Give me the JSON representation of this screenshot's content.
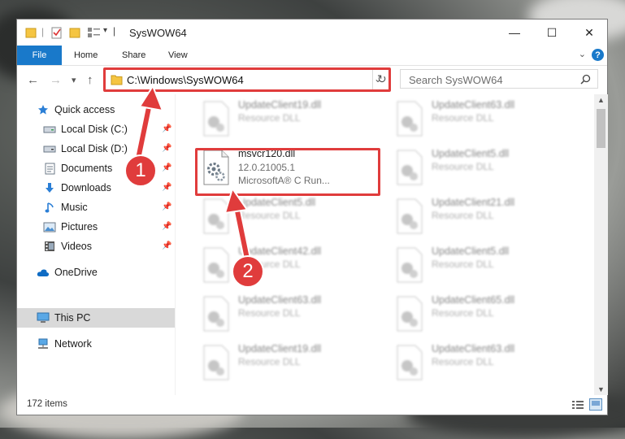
{
  "window": {
    "title": "SysWOW64",
    "minimize": "—",
    "maximize": "☐",
    "close": "✕"
  },
  "ribbon": {
    "tabs": [
      "File",
      "Home",
      "Share",
      "View"
    ],
    "help": "?"
  },
  "navigation": {
    "back": "←",
    "forward": "→",
    "recent": "▾",
    "up": "↑",
    "address": "C:\\Windows\\SysWOW64",
    "refresh": "↻",
    "search_placeholder": "Search SysWOW64"
  },
  "sidebar": {
    "items": [
      {
        "label": "Quick access",
        "icon": "star-icon",
        "pinned": false
      },
      {
        "label": "Local Disk (C:)",
        "icon": "drive-icon",
        "pinned": true
      },
      {
        "label": "Local Disk (D:)",
        "icon": "drive-icon",
        "pinned": true
      },
      {
        "label": "Documents",
        "icon": "documents-icon",
        "pinned": true
      },
      {
        "label": "Downloads",
        "icon": "download-icon",
        "pinned": true
      },
      {
        "label": "Music",
        "icon": "music-icon",
        "pinned": true
      },
      {
        "label": "Pictures",
        "icon": "pictures-icon",
        "pinned": true
      },
      {
        "label": "Videos",
        "icon": "videos-icon",
        "pinned": true
      },
      {
        "label": "OneDrive",
        "icon": "cloud-icon",
        "pinned": false
      },
      {
        "label": "This PC",
        "icon": "computer-icon",
        "pinned": false
      },
      {
        "label": "Network",
        "icon": "network-icon",
        "pinned": false
      }
    ],
    "selected": "This PC"
  },
  "files": {
    "highlighted": {
      "name": "msvcr120.dll",
      "version": "12.0.21005.1",
      "description": "MicrosoftA® C Run..."
    },
    "blurred": [
      {
        "name": "UpdateClient19.dll",
        "type": "Resource DLL"
      },
      {
        "name": "UpdateClient63.dll",
        "type": "Resource DLL"
      },
      {
        "name": "UpdateClient5.dll",
        "type": "Resource DLL"
      },
      {
        "name": "UpdateClient5.dll",
        "type": "Resource DLL"
      },
      {
        "name": "UpdateClient21.dll",
        "type": "Resource DLL"
      },
      {
        "name": "UpdateClient42.dll",
        "type": "Resource DLL"
      },
      {
        "name": "UpdateClient5.dll",
        "type": "Resource DLL"
      },
      {
        "name": "UpdateClient63.dll",
        "type": "Resource DLL"
      },
      {
        "name": "UpdateClient65.dll",
        "type": "Resource DLL"
      },
      {
        "name": "UpdateClient19.dll",
        "type": "Resource DLL"
      },
      {
        "name": "UpdateClient63.dll",
        "type": "Resource DLL"
      }
    ]
  },
  "status": {
    "item_count": "172 items"
  },
  "annotations": {
    "step1": "1",
    "step2": "2",
    "color": "#e03c3c"
  }
}
